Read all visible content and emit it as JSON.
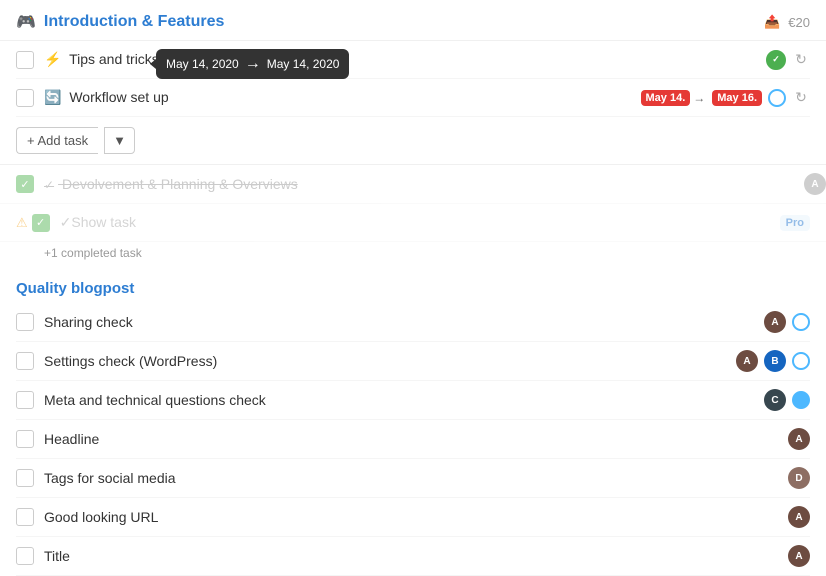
{
  "header": {
    "icon": "🎮",
    "title": "Introduction & Features",
    "price": "€20",
    "upload_icon": "📤"
  },
  "section1": {
    "tasks": [
      {
        "id": "tips",
        "label": "Tips and tricks",
        "emoji": "⚡",
        "checked": false,
        "has_status_green": true,
        "has_sync": true,
        "has_tooltip": true
      },
      {
        "id": "workflow",
        "label": "Workflow set up",
        "emoji": "🔄",
        "checked": false,
        "date_from": "May 14.",
        "date_to": "May 16.",
        "has_status_blue": true,
        "has_sync": true
      }
    ]
  },
  "add_task": {
    "label": "+ Add task",
    "dropdown": "▼"
  },
  "section2": {
    "title": "Devolvement & Planning & Overviews",
    "show_task_label": "✓Show task",
    "completed_count": "+1 completed task",
    "warning": true,
    "pro_label": "Pro"
  },
  "section3": {
    "title": "Quality blogpost",
    "tasks": [
      {
        "id": "sharing",
        "label": "Sharing check",
        "checked": false,
        "avatar_color": "#6d4c41",
        "avatar_initials": "A",
        "has_status_blue": true
      },
      {
        "id": "settings",
        "label": "Settings check (WordPress)",
        "checked": false,
        "avatar_color": "#6d4c41",
        "avatar_initials": "A",
        "avatar2_color": "#1565c0",
        "avatar2_initials": "B",
        "has_status_blue": true
      },
      {
        "id": "meta",
        "label": "Meta and technical questions check",
        "checked": false,
        "avatar_color": "#37474f",
        "avatar_initials": "C",
        "has_status_blue_filled": true
      },
      {
        "id": "headline",
        "label": "Headline",
        "checked": false,
        "avatar_color": "#6d4c41",
        "avatar_initials": "A"
      },
      {
        "id": "tags",
        "label": "Tags for social media",
        "checked": false,
        "avatar_color": "#8d6e63",
        "avatar_initials": "D"
      },
      {
        "id": "url",
        "label": "Good looking URL",
        "checked": false,
        "avatar_color": "#6d4c41",
        "avatar_initials": "A"
      },
      {
        "id": "title",
        "label": "Title",
        "checked": false,
        "avatar_color": "#6d4c41",
        "avatar_initials": "A"
      }
    ]
  },
  "tooltip": {
    "text": "May 14, 2020",
    "arrow": "→"
  }
}
